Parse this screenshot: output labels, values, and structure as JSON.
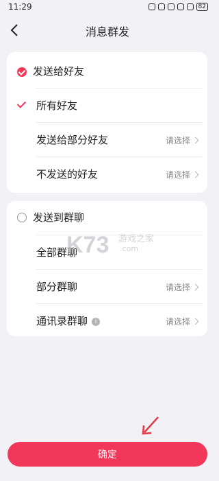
{
  "status_bar": {
    "time": "11:29",
    "battery": "82"
  },
  "header": {
    "title": "消息群发"
  },
  "section_friends": {
    "title": "发送给好友",
    "all_friends": "所有好友",
    "partial_friends": "发送给部分好友",
    "excluded_friends": "不发送的好友",
    "select_hint": "请选择"
  },
  "section_groups": {
    "title": "发送到群聊",
    "all_groups": "全部群聊",
    "partial_groups": "部分群聊",
    "contact_groups": "通讯录群聊",
    "info_mark": "i",
    "select_hint": "请选择"
  },
  "watermark": {
    "brand": "K73",
    "tagline": "游戏之家",
    "domain": ".com"
  },
  "actions": {
    "confirm_label": "确定"
  },
  "colors": {
    "accent": "#f2385a",
    "background": "#f2f2f6",
    "card": "#ffffff",
    "hint_text": "#8a8a8a"
  }
}
